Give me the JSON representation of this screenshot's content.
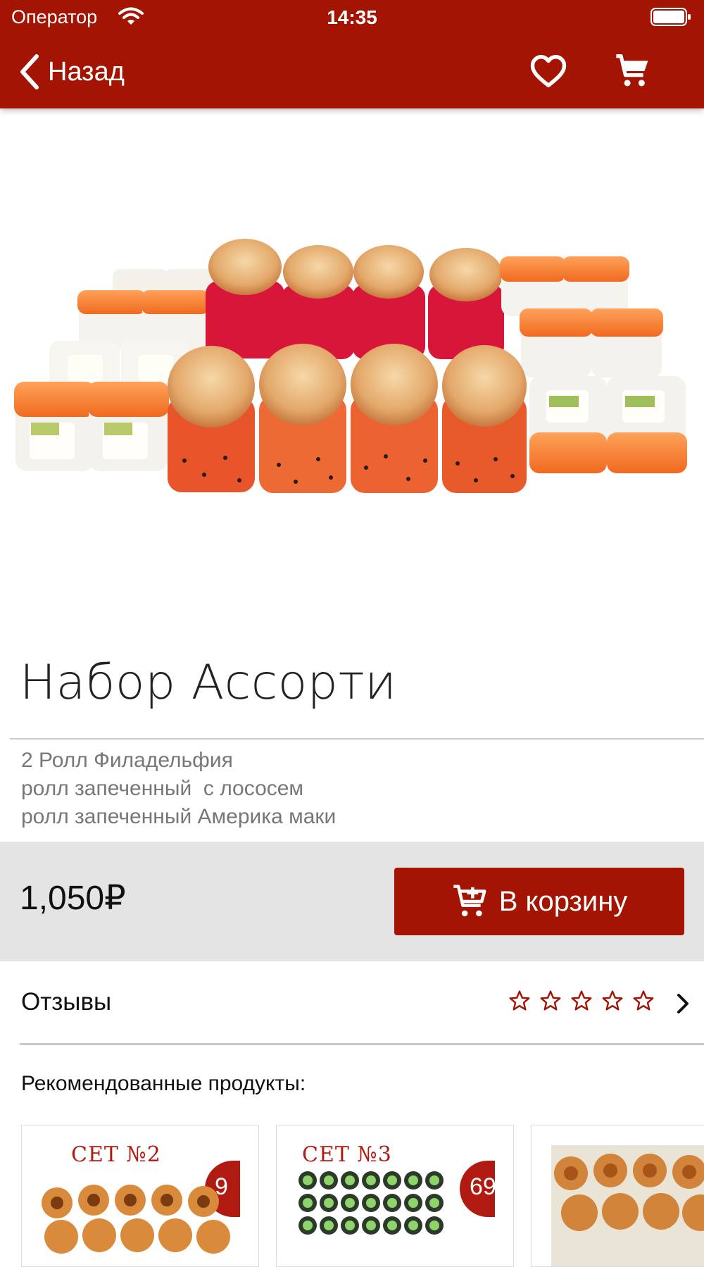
{
  "status": {
    "carrier": "Оператор",
    "time": "14:35"
  },
  "header": {
    "back_label": "Назад"
  },
  "product": {
    "title": "Набор Ассорти",
    "description": "2 Ролл Филадельфия\nролл запеченный  с лососем\nролл запеченный Америка маки",
    "price": "1,050₽",
    "add_to_cart": "В корзину"
  },
  "reviews": {
    "label": "Отзывы",
    "rating": 0,
    "max_rating": 5
  },
  "recommended": {
    "title": "Рекомендованные продукты:",
    "items": [
      {
        "label": "СЕТ №2",
        "badge": "9"
      },
      {
        "label": "СЕТ №3",
        "badge": "69"
      },
      {
        "label": ""
      }
    ]
  },
  "colors": {
    "brand": "#a31402",
    "price_band": "#e4e4e4"
  }
}
